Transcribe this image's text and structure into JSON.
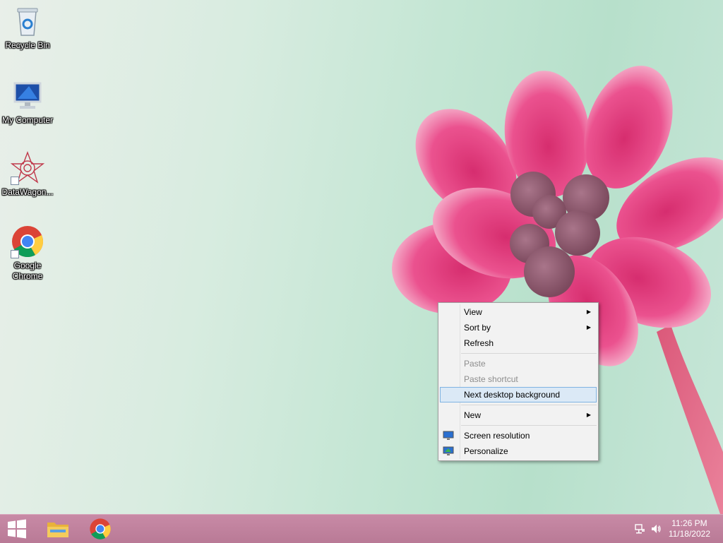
{
  "desktop_icons": [
    {
      "label": "Recycle Bin",
      "icon": "recycle-bin-icon"
    },
    {
      "label": "My Computer",
      "icon": "computer-icon"
    },
    {
      "label": "DataWagon...",
      "icon": "datawagon-icon"
    },
    {
      "label": "Google Chrome",
      "icon": "chrome-icon"
    }
  ],
  "context_menu": {
    "view": "View",
    "sort_by": "Sort by",
    "refresh": "Refresh",
    "paste": "Paste",
    "paste_shortcut": "Paste shortcut",
    "next_background": "Next desktop background",
    "new": "New",
    "screen_resolution": "Screen resolution",
    "personalize": "Personalize"
  },
  "taskbar": {
    "time": "11:26 PM",
    "date": "11/18/2022"
  },
  "colors": {
    "taskbar": "#c08099",
    "menu_hover": "#dbe9f6",
    "menu_hover_border": "#7fb3e2"
  }
}
